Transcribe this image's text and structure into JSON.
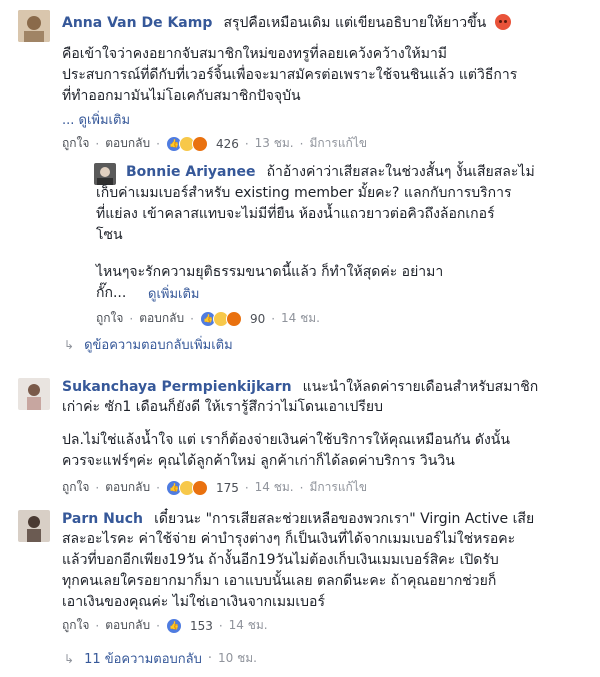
{
  "comments": [
    {
      "name": "Anna Van De Kamp",
      "headline": "สรุปคือเหมือนเดิม แต่เขียนอธิบายให้ยาวขึ้น",
      "body": "คือเข้าใจว่าคงอยากจับสมาชิกใหม่ของทรูที่ลอยเคว้งคว้างให้มามี\nประสบการณ์ที่ดีกับที่เวอร์จิ้นเพื่อจะมาสมัครต่อเพราะใช้จนชินแล้ว แต่วิธีการ\nที่ทำออกมามันไม่โอเคกับสมาชิกปัจจุบัน",
      "see_more": "... ดูเพิ่มเติม",
      "like": "ถูกใจ",
      "reply": "ตอบกลับ",
      "reaction_count": "426",
      "time": "13 ชม.",
      "edited": "มีการแก้ไข"
    },
    {
      "name": "Bonnie Ariyanee",
      "headline": "ถ้าอ้างค่าว่าเสียสละในช่วงสั้นๆ งั้นเสียสละไม่",
      "body": "เก็บค่าเมมเบอร์สำหรับ existing member มั้ยคะ? แลกกับการบริการ\nที่แย่ลง เข้าคลาสแทบจะไม่มีที่ยืน ห้องน้ำแถวยาวต่อคิวถึงล้อกเกอร์\nโซน",
      "body2": "ไหนๆจะรักความยุติธรรมขนาดนี้แล้ว ก็ทำให้สุดค่ะ อย่ามา\nกั๊ก...",
      "see_more": "ดูเพิ่มเติม",
      "like": "ถูกใจ",
      "reply": "ตอบกลับ",
      "reaction_count": "90",
      "time": "14 ชม."
    },
    {
      "name": "Sukanchaya Permpienkijkarn",
      "headline": "แนะนำให้ลดค่ารายเดือนสำหรับสมาชิก",
      "body": "เก่าค่ะ ซัก1 เดือนก็ยังดี ให้เรารู้สึกว่าไม่โดนเอาเปรียบ",
      "body2": "ปล.ไม่ใช่แล้งน้ำใจ แต่ เราก็ต้องจ่ายเงินค่าใช้บริการให้คุณเหมือนกัน ดังนั้น\nควรจะแฟร์ๆค่ะ คุณได้ลูกค้าใหม่ ลูกค้าเก่าก็ได้ลดค่าบริการ วินวิน",
      "like": "ถูกใจ",
      "reply": "ตอบกลับ",
      "reaction_count": "175",
      "time": "14 ชม.",
      "edited": "มีการแก้ไข"
    },
    {
      "name": "Parn Nuch",
      "headline": "เดี๋ยวนะ \"การเสียสละช่วยเหลือของพวกเรา\" Virgin Active เสีย",
      "body": "สละอะไรคะ ค่าใช้จ่าย ค่าบำรุงต่างๆ ก็เป็นเงินที่ได้จากเมมเบอร์ไม่ใช่หรอคะ\nแล้วที่บอกอีกเพียง19วัน ถ้างั้นอีก19วันไม่ต้องเก็บเงินเมมเบอร์สิคะ เปิดรับ\nทุกคนเลยใครอยากมาก็มา เอาแบบนั้นเลย ตลกดีนะคะ ถ้าคุณอยากช่วยก็\nเอาเงินของคุณค่ะ ไม่ใช่เอาเงินจากเมมเบอร์",
      "like": "ถูกใจ",
      "reply": "ตอบกลับ",
      "reaction_count": "153",
      "time": "14 ชม."
    }
  ],
  "more_replies_label": "ดูข้อความตอบกลับเพิ่มเติม",
  "replies_count_label": "11 ข้อความตอบกลับ",
  "replies_time": "10 ชม.",
  "colors": {
    "name": "#365899",
    "text": "#1d2129",
    "meta": "#90949c",
    "like": "#4f7ce0"
  }
}
